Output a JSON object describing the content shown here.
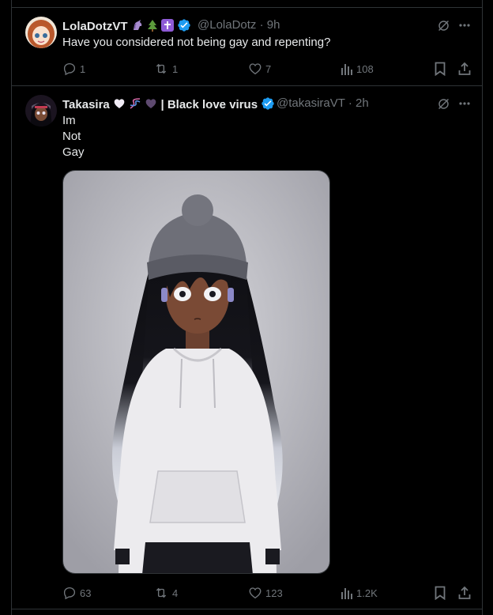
{
  "tweet1": {
    "display_name": "LolaDotzVT",
    "handle": "@LolaDotz",
    "time": "9h",
    "text": "Have you considered not being gay and repenting?",
    "replies": "1",
    "reposts": "1",
    "likes": "7",
    "views": "108"
  },
  "tweet2": {
    "display_name": "Takasira",
    "display_name_suffix": "| Black love virus",
    "handle": "@takasiraVT",
    "time": "2h",
    "text_lines": [
      "Im",
      "Not",
      "Gay"
    ],
    "replies": "63",
    "reposts": "4",
    "likes": "123",
    "views": "1.2K"
  },
  "separator": "·",
  "colors": {
    "background": "#000000",
    "text": "#e7e9ea",
    "muted": "#71767b",
    "border": "#2f3336",
    "verified": "#1d9bf0"
  },
  "icons": [
    "grok-icon",
    "more-icon",
    "reply-icon",
    "repost-icon",
    "like-icon",
    "views-icon",
    "bookmark-icon",
    "share-icon",
    "verified-badge-icon"
  ]
}
